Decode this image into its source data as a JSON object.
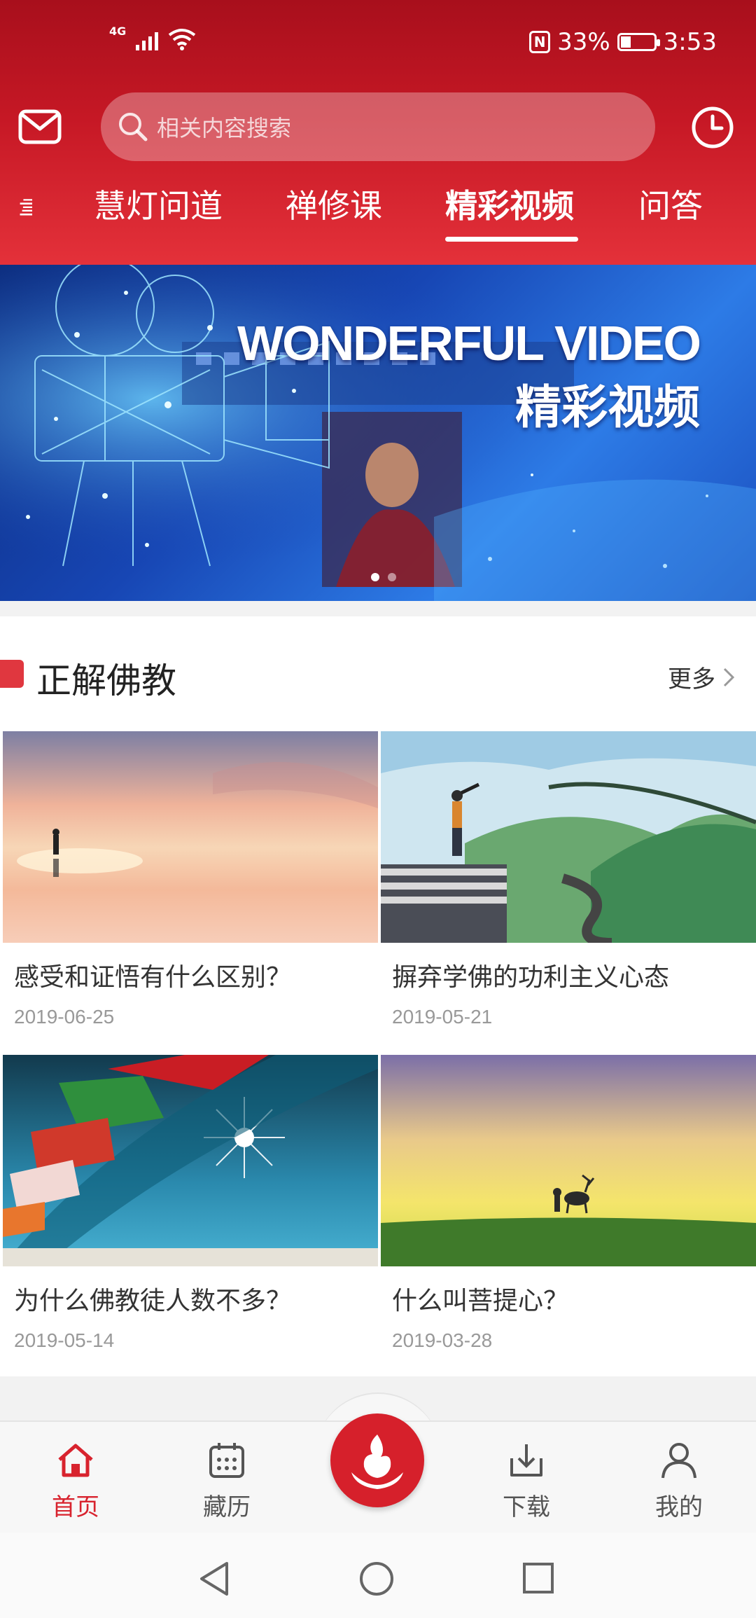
{
  "status_bar": {
    "network": "4G",
    "battery": "33%",
    "time": "3:53"
  },
  "search": {
    "placeholder": "相关内容搜索"
  },
  "tabs": [
    {
      "label": "慧灯问道"
    },
    {
      "label": "禅修课"
    },
    {
      "label": "精彩视频",
      "active": true
    },
    {
      "label": "问答"
    }
  ],
  "banner": {
    "title": "WONDERFUL VIDEO",
    "subtitle": "精彩视频"
  },
  "section": {
    "title": "正解佛教",
    "more": "更多",
    "cards": [
      {
        "title": "感受和证悟有什么区别？",
        "date": "2019-06-25"
      },
      {
        "title": "摒弃学佛的功利主义心态",
        "date": "2019-05-21"
      },
      {
        "title": "为什么佛教徒人数不多？",
        "date": "2019-05-14"
      },
      {
        "title": "什么叫菩提心？",
        "date": "2019-03-28"
      }
    ]
  },
  "bottom_nav": [
    {
      "label": "首页",
      "icon": "home-icon",
      "active": true
    },
    {
      "label": "藏历",
      "icon": "calendar-icon"
    },
    {
      "label": "下载",
      "icon": "download-icon"
    },
    {
      "label": "我的",
      "icon": "profile-icon"
    }
  ],
  "colors": {
    "primary": "#d8232e",
    "header_top": "#a80f1c",
    "header_bottom": "#e4313a"
  }
}
